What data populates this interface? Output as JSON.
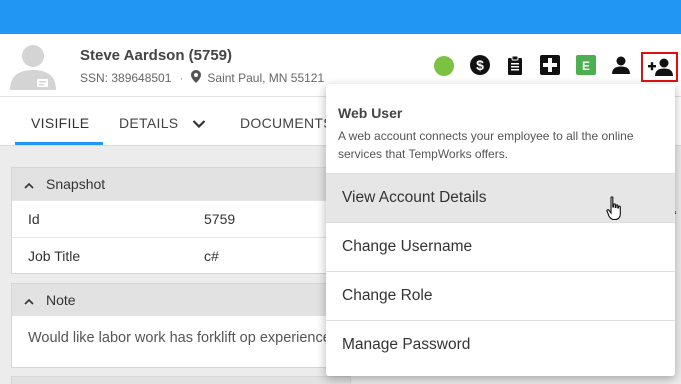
{
  "employee": {
    "name": "Steve Aardson (5759)",
    "ssn": "SSN: 389648501",
    "location": "Saint Paul, MN 55121"
  },
  "header_icons": {
    "status_color": "#7cc242",
    "dollar": "dollar-icon",
    "clipboard": "clipboard-icon",
    "medical": "medical-plus-icon",
    "e_label": "E",
    "e_color": "#4caf50",
    "person": "person-icon",
    "add_user": "add-user-icon",
    "highlight_color": "#e01010"
  },
  "tabs": {
    "visifile": "VISIFILE",
    "details": "DETAILS",
    "documents": "DOCUMENTS"
  },
  "snapshot": {
    "title": "Snapshot",
    "rows": [
      {
        "key": "Id",
        "value": "5759"
      },
      {
        "key": "Job Title",
        "value": "c#"
      }
    ]
  },
  "note": {
    "title": "Note",
    "text": "Would like labor work has forklift op experience"
  },
  "popup": {
    "title": "Web User",
    "description": "A web account connects your employee to all the online services that TempWorks offers.",
    "items": [
      "View Account Details",
      "Change Username",
      "Change Role",
      "Manage Password"
    ]
  },
  "colors": {
    "topbar": "#2196f3",
    "accent": "#2196f3"
  }
}
